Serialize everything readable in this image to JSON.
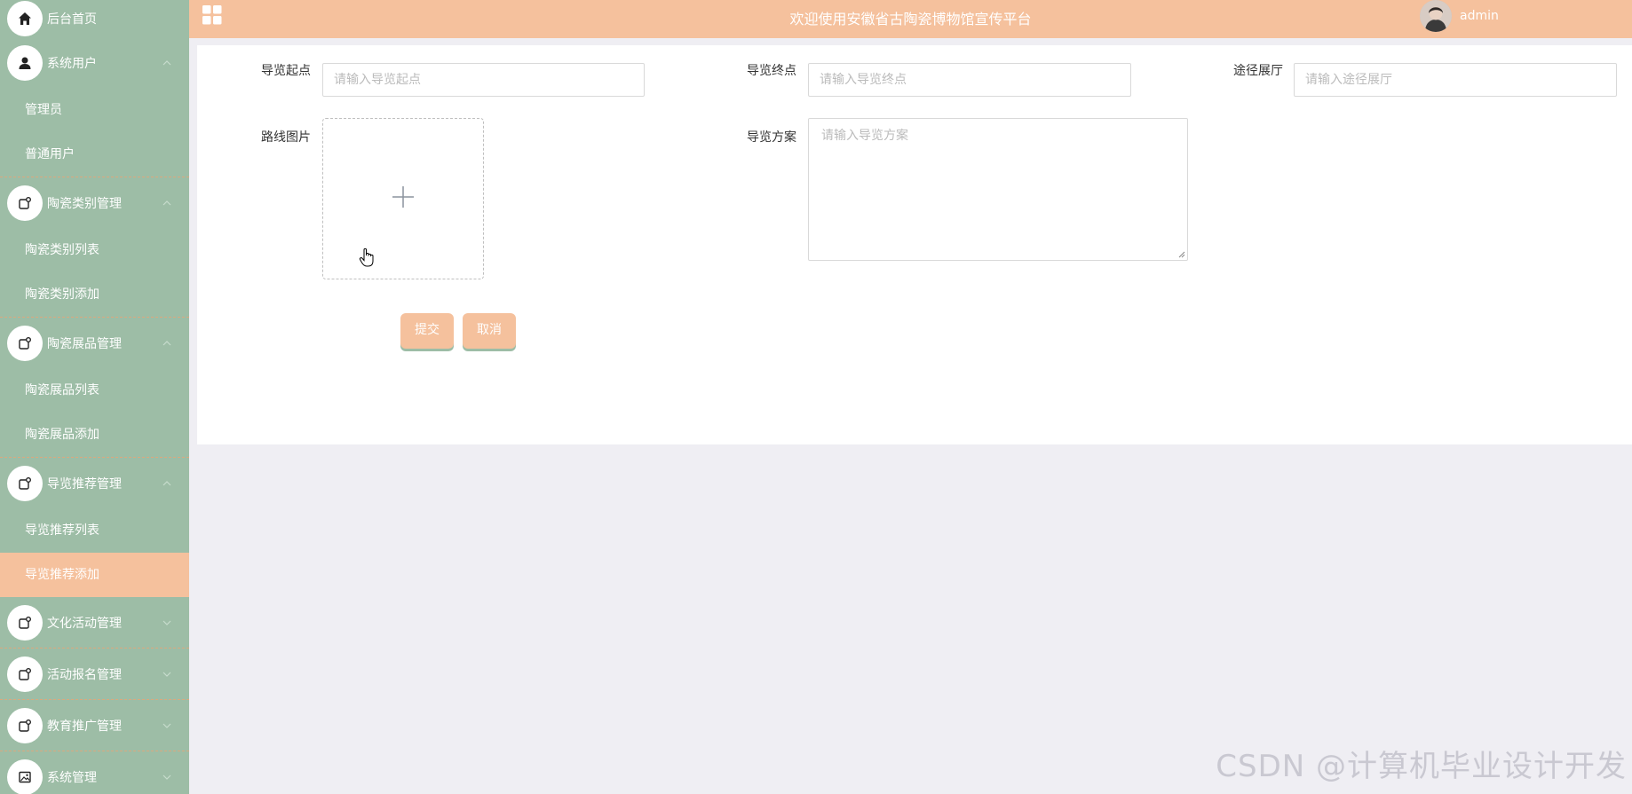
{
  "header": {
    "title": "欢迎使用安徽省古陶瓷博物馆宣传平台",
    "username": "admin"
  },
  "sidebar": {
    "home": "后台首页",
    "groups": [
      {
        "label": "系统用户",
        "items": [
          "管理员",
          "普通用户"
        ]
      },
      {
        "label": "陶瓷类别管理",
        "items": [
          "陶瓷类别列表",
          "陶瓷类别添加"
        ]
      },
      {
        "label": "陶瓷展品管理",
        "items": [
          "陶瓷展品列表",
          "陶瓷展品添加"
        ]
      },
      {
        "label": "导览推荐管理",
        "items": [
          "导览推荐列表",
          "导览推荐添加"
        ]
      },
      {
        "label": "文化活动管理"
      },
      {
        "label": "活动报名管理"
      },
      {
        "label": "教育推广管理"
      },
      {
        "label": "系统管理"
      }
    ],
    "active_item": "导览推荐添加"
  },
  "form": {
    "start_label": "导览起点",
    "start_placeholder": "请输入导览起点",
    "end_label": "导览终点",
    "end_placeholder": "请输入导览终点",
    "hall_label": "途径展厅",
    "hall_placeholder": "请输入途径展厅",
    "image_label": "路线图片",
    "plan_label": "导览方案",
    "plan_placeholder": "请输入导览方案",
    "submit": "提交",
    "cancel": "取消"
  },
  "watermark": "CSDN @计算机毕业设计开发",
  "colors": {
    "sidebar_bg": "#9dbda6",
    "accent": "#f5c19d",
    "page_bg": "#efeef3"
  }
}
